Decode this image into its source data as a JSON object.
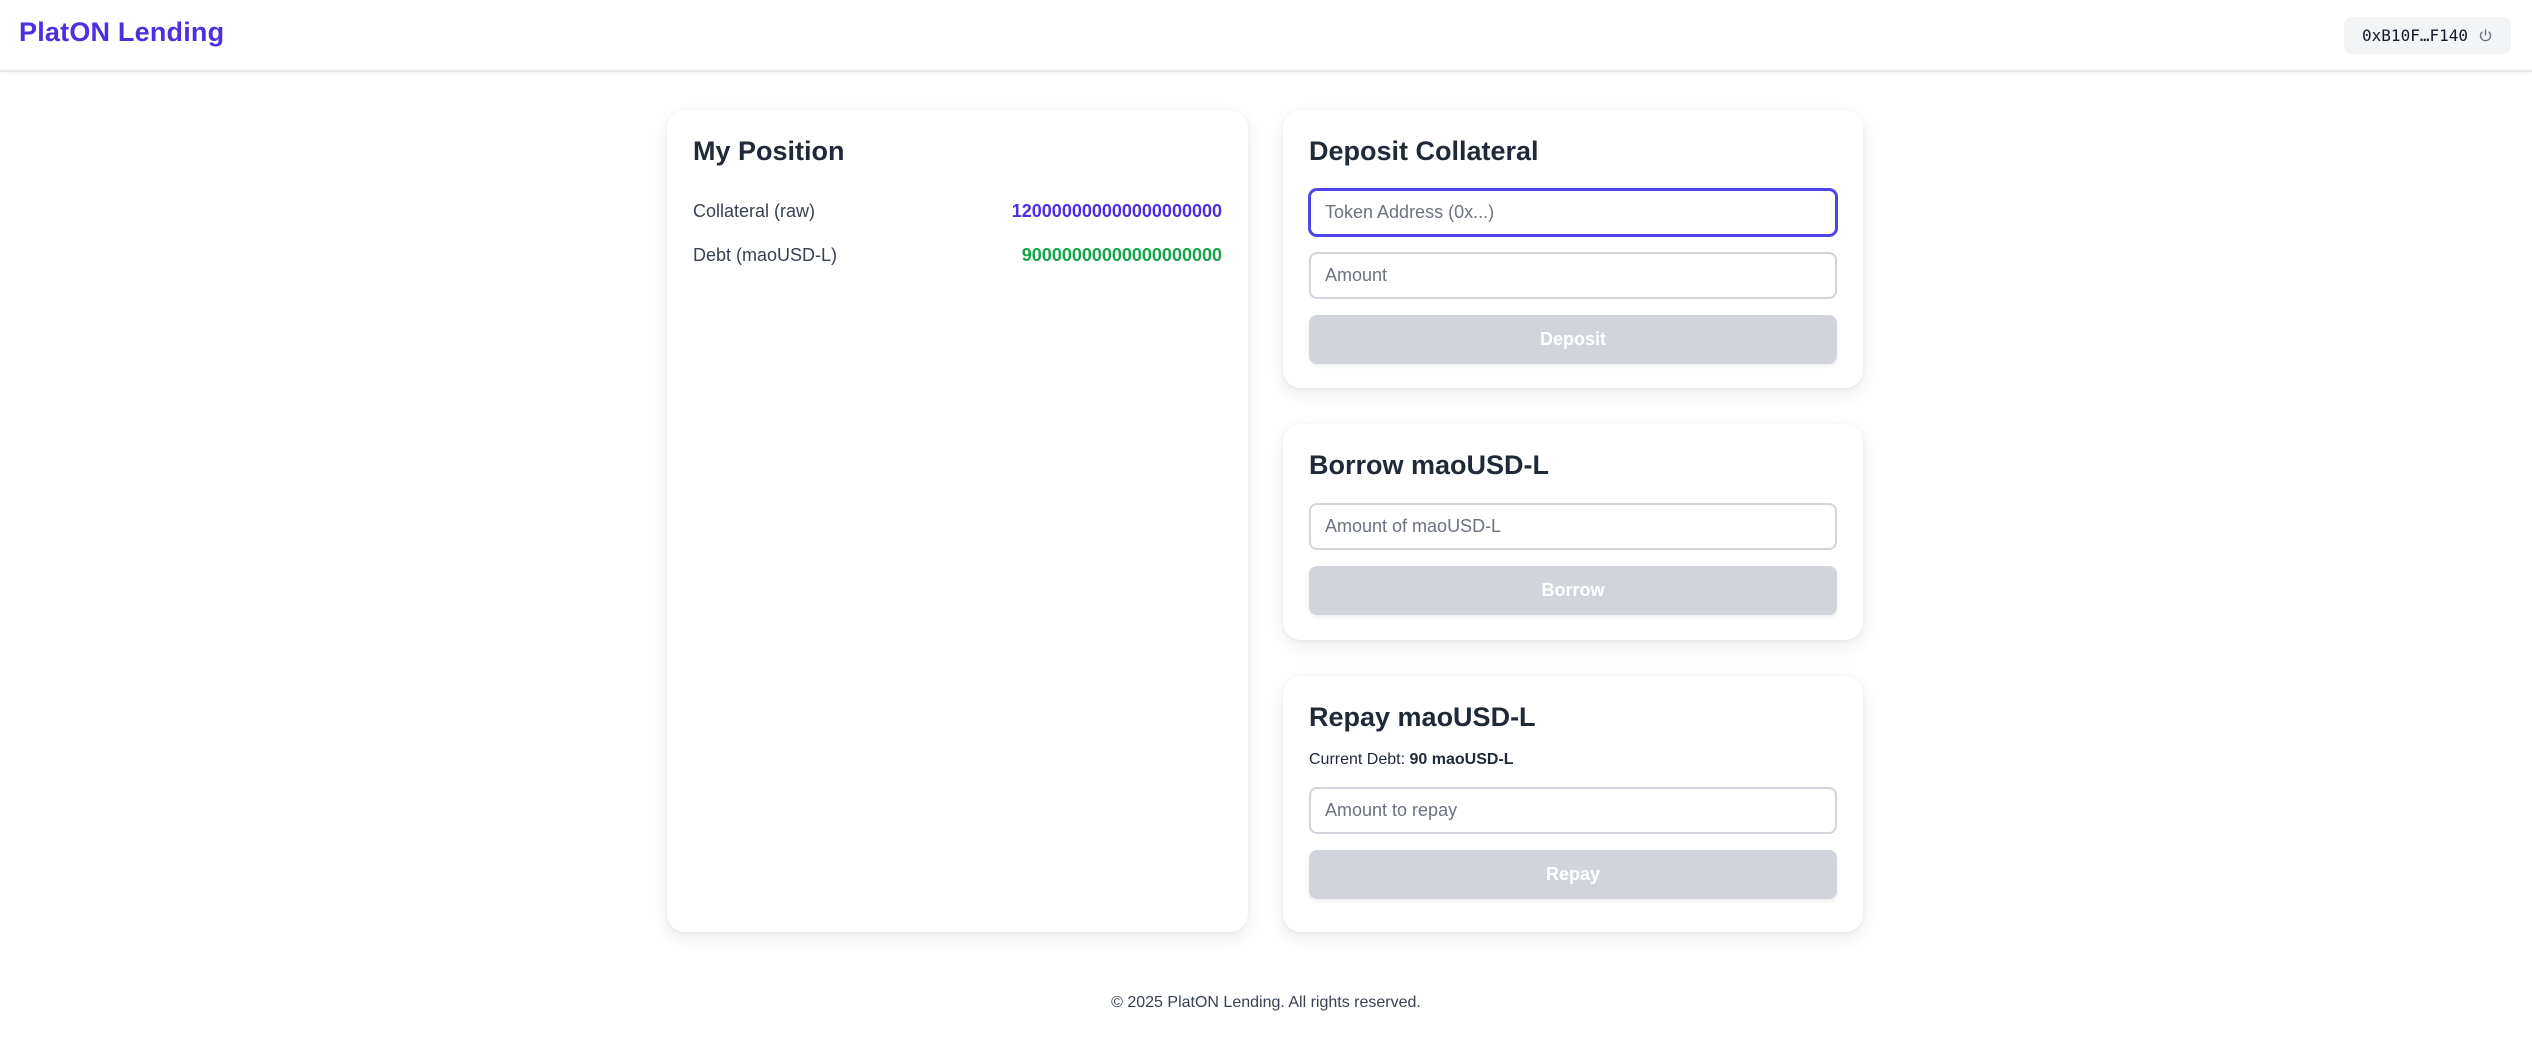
{
  "header": {
    "brand": "PlatON Lending",
    "wallet_address": "0xB10F…F140",
    "wallet_icon": "power-icon"
  },
  "position": {
    "title": "My Position",
    "collateral_label": "Collateral (raw)",
    "collateral_value": "120000000000000000000",
    "debt_label": "Debt (maoUSD-L)",
    "debt_value": "90000000000000000000"
  },
  "deposit": {
    "title": "Deposit Collateral",
    "token_placeholder": "Token Address (0x...)",
    "amount_placeholder": "Amount",
    "button_label": "Deposit"
  },
  "borrow": {
    "title": "Borrow maoUSD-L",
    "amount_placeholder": "Amount of maoUSD-L",
    "button_label": "Borrow"
  },
  "repay": {
    "title": "Repay maoUSD-L",
    "current_debt_label": "Current Debt:",
    "current_debt_value": "90 maoUSD-L",
    "amount_placeholder": "Amount to repay",
    "button_label": "Repay"
  },
  "footer": {
    "text": "© 2025 PlatON Lending. All rights reserved."
  },
  "colors": {
    "brand": "#4f2de0",
    "collateral": "#4f2de0",
    "debt": "#16a34a",
    "disabled_button": "#d1d5db",
    "focus_ring": "#4f46e5"
  }
}
